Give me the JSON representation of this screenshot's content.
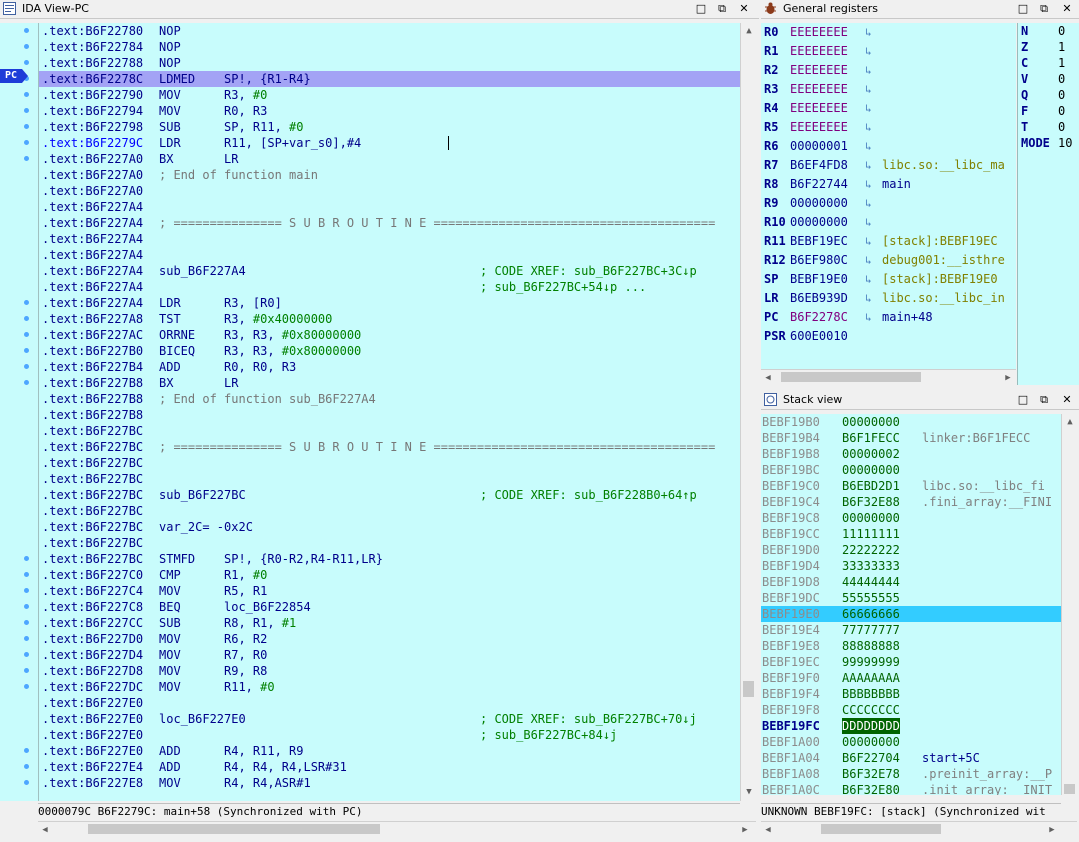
{
  "ida": {
    "title": "IDA View-PC",
    "pc_label": "PC",
    "status": "0000079C B6F2279C: main+58 (Synchronized with PC)",
    "lines": [
      {
        "addr": ".text:B6F22780",
        "ins": "NOP",
        "ops": ""
      },
      {
        "addr": ".text:B6F22784",
        "ins": "NOP",
        "ops": ""
      },
      {
        "addr": ".text:B6F22788",
        "ins": "NOP",
        "ops": ""
      },
      {
        "addr": ".text:B6F2278C",
        "ins": "LDMED",
        "ops": "SP!, {R1-R4}"
      },
      {
        "addr": ".text:B6F22790",
        "ins": "MOV",
        "ops": "R3, ",
        "imm": "#0"
      },
      {
        "addr": ".text:B6F22794",
        "ins": "MOV",
        "ops": "R0, R3"
      },
      {
        "addr": ".text:B6F22798",
        "ins": "SUB",
        "ops": "SP, R11, ",
        "imm": "#0"
      },
      {
        "addr": ".text:B6F2279C",
        "ins": "LDR",
        "ops": "R11, [SP+var_s0],#4"
      },
      {
        "addr": ".text:B6F227A0",
        "ins": "BX",
        "ops": "LR"
      },
      {
        "addr": ".text:B6F227A0",
        "cmt": "; End of function main"
      },
      {
        "addr": ".text:B6F227A0"
      },
      {
        "addr": ".text:B6F227A4"
      },
      {
        "addr": ".text:B6F227A4",
        "cmt": "; =============== S U B R O U T I N E ======================================="
      },
      {
        "addr": ".text:B6F227A4"
      },
      {
        "addr": ".text:B6F227A4"
      },
      {
        "addr": ".text:B6F227A4",
        "ins": "sub_B6F227A4",
        "xref": "; CODE XREF: sub_B6F227BC+3C↓p"
      },
      {
        "addr": ".text:B6F227A4",
        "xref": "; sub_B6F227BC+54↓p ..."
      },
      {
        "addr": ".text:B6F227A4",
        "ins": "LDR",
        "ops": "R3, [R0]"
      },
      {
        "addr": ".text:B6F227A8",
        "ins": "TST",
        "ops": "R3, ",
        "imm": "#0x40000000"
      },
      {
        "addr": ".text:B6F227AC",
        "ins": "ORRNE",
        "ops": "R3, R3, ",
        "imm": "#0x80000000"
      },
      {
        "addr": ".text:B6F227B0",
        "ins": "BICEQ",
        "ops": "R3, R3, ",
        "imm": "#0x80000000"
      },
      {
        "addr": ".text:B6F227B4",
        "ins": "ADD",
        "ops": "R0, R0, R3"
      },
      {
        "addr": ".text:B6F227B8",
        "ins": "BX",
        "ops": "LR"
      },
      {
        "addr": ".text:B6F227B8",
        "cmt": "; End of function sub_B6F227A4"
      },
      {
        "addr": ".text:B6F227B8"
      },
      {
        "addr": ".text:B6F227BC"
      },
      {
        "addr": ".text:B6F227BC",
        "cmt": "; =============== S U B R O U T I N E ======================================="
      },
      {
        "addr": ".text:B6F227BC"
      },
      {
        "addr": ".text:B6F227BC"
      },
      {
        "addr": ".text:B6F227BC",
        "ins": "sub_B6F227BC",
        "xref": "; CODE XREF: sub_B6F228B0+64↑p"
      },
      {
        "addr": ".text:B6F227BC"
      },
      {
        "addr": ".text:B6F227BC",
        "ins": "var_2C= -0x2C"
      },
      {
        "addr": ".text:B6F227BC"
      },
      {
        "addr": ".text:B6F227BC",
        "ins": "STMFD",
        "ops": "SP!, {R0-R2,R4-R11,LR}"
      },
      {
        "addr": ".text:B6F227C0",
        "ins": "CMP",
        "ops": "R1, ",
        "imm": "#0"
      },
      {
        "addr": ".text:B6F227C4",
        "ins": "MOV",
        "ops": "R5, R1"
      },
      {
        "addr": ".text:B6F227C8",
        "ins": "BEQ",
        "ops": "loc_B6F22854"
      },
      {
        "addr": ".text:B6F227CC",
        "ins": "SUB",
        "ops": "R8, R1, ",
        "imm": "#1"
      },
      {
        "addr": ".text:B6F227D0",
        "ins": "MOV",
        "ops": "R6, R2"
      },
      {
        "addr": ".text:B6F227D4",
        "ins": "MOV",
        "ops": "R7, R0"
      },
      {
        "addr": ".text:B6F227D8",
        "ins": "MOV",
        "ops": "R9, R8"
      },
      {
        "addr": ".text:B6F227DC",
        "ins": "MOV",
        "ops": "R11, ",
        "imm": "#0"
      },
      {
        "addr": ".text:B6F227E0"
      },
      {
        "addr": ".text:B6F227E0",
        "ins": "loc_B6F227E0",
        "xref": "; CODE XREF: sub_B6F227BC+70↓j"
      },
      {
        "addr": ".text:B6F227E0",
        "xref": "; sub_B6F227BC+84↓j"
      },
      {
        "addr": ".text:B6F227E0",
        "ins": "ADD",
        "ops": "R4, R11, R9"
      },
      {
        "addr": ".text:B6F227E4",
        "ins": "ADD",
        "ops": "R4, R4, R4,LSR#31"
      },
      {
        "addr": ".text:B6F227E8",
        "ins": "MOV",
        "ops": "R4, R4,ASR#1"
      }
    ]
  },
  "registers": {
    "title": "General registers",
    "regs": [
      {
        "name": "R0",
        "value": "EEEEEEEE",
        "changed": true,
        "desc": ""
      },
      {
        "name": "R1",
        "value": "EEEEEEEE",
        "changed": true,
        "desc": ""
      },
      {
        "name": "R2",
        "value": "EEEEEEEE",
        "changed": true,
        "desc": ""
      },
      {
        "name": "R3",
        "value": "EEEEEEEE",
        "changed": true,
        "desc": ""
      },
      {
        "name": "R4",
        "value": "EEEEEEEE",
        "changed": true,
        "desc": ""
      },
      {
        "name": "R5",
        "value": "EEEEEEEE",
        "changed": true,
        "desc": ""
      },
      {
        "name": "R6",
        "value": "00000001",
        "changed": false,
        "desc": ""
      },
      {
        "name": "R7",
        "value": "B6EF4FD8",
        "changed": false,
        "desc": "libc.so:__libc_ma",
        "kind": "data"
      },
      {
        "name": "R8",
        "value": "B6F22744",
        "changed": false,
        "desc": "main",
        "kind": "code"
      },
      {
        "name": "R9",
        "value": "00000000",
        "changed": false,
        "desc": ""
      },
      {
        "name": "R10",
        "value": "00000000",
        "changed": false,
        "desc": ""
      },
      {
        "name": "R11",
        "value": "BEBF19EC",
        "changed": false,
        "desc": "[stack]:BEBF19EC",
        "kind": "data"
      },
      {
        "name": "R12",
        "value": "B6EF980C",
        "changed": false,
        "desc": "debug001:__isthre",
        "kind": "data"
      },
      {
        "name": "SP",
        "value": "BEBF19E0",
        "changed": false,
        "desc": "[stack]:BEBF19E0",
        "kind": "data"
      },
      {
        "name": "LR",
        "value": "B6EB939D",
        "changed": false,
        "desc": "libc.so:__libc_in",
        "kind": "data"
      },
      {
        "name": "PC",
        "value": "B6F2278C",
        "changed": true,
        "desc": "main+48",
        "kind": "code"
      },
      {
        "name": "PSR",
        "value": "600E0010",
        "changed": false,
        "desc": "",
        "noarrow": true
      }
    ],
    "flags": [
      {
        "name": "N",
        "value": "0"
      },
      {
        "name": "Z",
        "value": "1"
      },
      {
        "name": "C",
        "value": "1"
      },
      {
        "name": "V",
        "value": "0"
      },
      {
        "name": "Q",
        "value": "0"
      },
      {
        "name": "F",
        "value": "0"
      },
      {
        "name": "T",
        "value": "0"
      },
      {
        "name": "MODE",
        "value": "10"
      }
    ]
  },
  "stack": {
    "title": "Stack view",
    "status": "UNKNOWN BEBF19FC: [stack] (Synchronized wit",
    "rows": [
      {
        "addr": "BEBF19B0",
        "value": "00000000",
        "desc": ""
      },
      {
        "addr": "BEBF19B4",
        "value": "B6F1FECC",
        "desc": "linker:B6F1FECC"
      },
      {
        "addr": "BEBF19B8",
        "value": "00000002",
        "desc": ""
      },
      {
        "addr": "BEBF19BC",
        "value": "00000000",
        "desc": ""
      },
      {
        "addr": "BEBF19C0",
        "value": "B6EBD2D1",
        "desc": "libc.so:__libc_fi"
      },
      {
        "addr": "BEBF19C4",
        "value": "B6F32E88",
        "desc": ".fini_array:__FINI"
      },
      {
        "addr": "BEBF19C8",
        "value": "00000000",
        "desc": ""
      },
      {
        "addr": "BEBF19CC",
        "value": "11111111",
        "desc": ""
      },
      {
        "addr": "BEBF19D0",
        "value": "22222222",
        "desc": ""
      },
      {
        "addr": "BEBF19D4",
        "value": "33333333",
        "desc": ""
      },
      {
        "addr": "BEBF19D8",
        "value": "44444444",
        "desc": ""
      },
      {
        "addr": "BEBF19DC",
        "value": "55555555",
        "desc": ""
      },
      {
        "addr": "BEBF19E0",
        "value": "66666666",
        "desc": "",
        "hl": true
      },
      {
        "addr": "BEBF19E4",
        "value": "77777777",
        "desc": ""
      },
      {
        "addr": "BEBF19E8",
        "value": "88888888",
        "desc": ""
      },
      {
        "addr": "BEBF19EC",
        "value": "99999999",
        "desc": ""
      },
      {
        "addr": "BEBF19F0",
        "value": "AAAAAAAA",
        "desc": ""
      },
      {
        "addr": "BEBF19F4",
        "value": "BBBBBBBB",
        "desc": ""
      },
      {
        "addr": "BEBF19F8",
        "value": "CCCCCCCC",
        "desc": ""
      },
      {
        "addr": "BEBF19FC",
        "value": "DDDDDDDD",
        "desc": "",
        "cur": true
      },
      {
        "addr": "BEBF1A00",
        "value": "00000000",
        "desc": ""
      },
      {
        "addr": "BEBF1A04",
        "value": "B6F22704",
        "desc": "start+5C",
        "code": true
      },
      {
        "addr": "BEBF1A08",
        "value": "B6F32E78",
        "desc": ".preinit_array:__P"
      },
      {
        "addr": "BEBF1A0C",
        "value": "B6F32E80",
        "desc": ".init_array:__INIT"
      }
    ]
  }
}
